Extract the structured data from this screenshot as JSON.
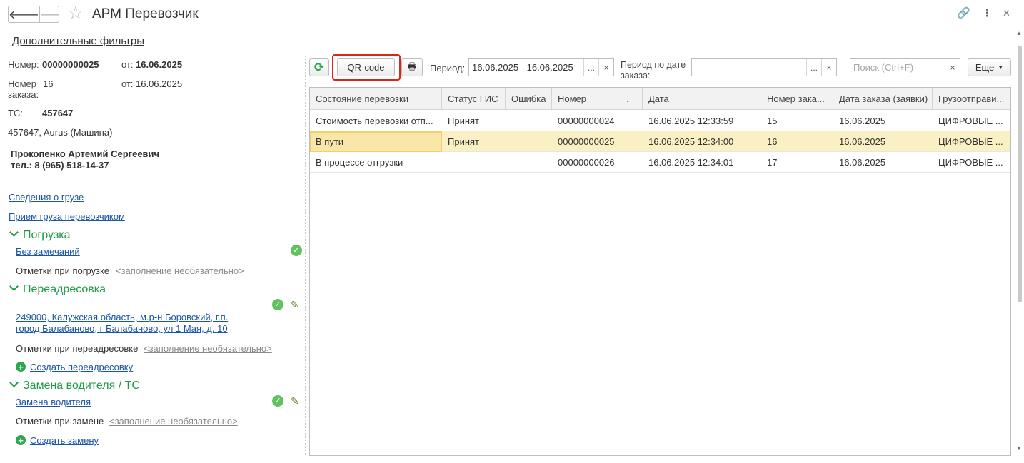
{
  "window": {
    "title": "АРМ Перевозчик",
    "nav_back": "🡐",
    "nav_forward": "🡒",
    "star": "☆",
    "link_icon": "🔗",
    "more_icon": "⋮",
    "close_icon": "✕"
  },
  "filters_link": "Дополнительные фильтры",
  "details": {
    "number_label": "Номер:",
    "number_value": "00000000025",
    "from_label": "от:",
    "number_date": "16.06.2025",
    "order_label_1": "Номер",
    "order_label_2": "заказа:",
    "order_value": "16",
    "order_from_label": "от:",
    "order_date": "16.06.2025",
    "vehicle_label": "ТС:",
    "vehicle_value": "457647",
    "vehicle_desc": "457647, Aurus (Машина)",
    "driver_name": "Прокопенко Артемий Сергеевич",
    "driver_phone": "тел.: 8 (965) 518-14-37"
  },
  "links": {
    "cargo_info": "Сведения о грузе",
    "cargo_accept": "Прием груза перевозчиком"
  },
  "sections": {
    "loading": {
      "title": "Погрузка",
      "link": "Без замечаний",
      "notes_label": "Отметки при погрузке",
      "notes_placeholder": "<заполнение необязательно>"
    },
    "redirect": {
      "title": "Переадресовка",
      "address_line1": "249000, Калужская область, м.р-н Боровский, г.п.",
      "address_line2": "город Балабаново, г Балабаново, ул 1 Мая, д. 10",
      "notes_label": "Отметки при переадресовке",
      "notes_placeholder": "<заполнение необязательно>",
      "create_link": "Создать переадресовку"
    },
    "driver_change": {
      "title": "Замена водителя / ТС",
      "link": "Замена водителя",
      "notes_label": "Отметки при замене",
      "notes_placeholder": "<заполнение необязательно>",
      "create_link": "Создать замену"
    }
  },
  "toolbar": {
    "refresh_icon": "⟳",
    "qr_label": "QR-code",
    "print_icon": "🖶",
    "period_label": "Период:",
    "period_value": "16.06.2025 - 16.06.2025",
    "period_by_order_label_1": "Период по дате",
    "period_by_order_label_2": "заказа:",
    "period_by_order_value": "",
    "search_placeholder": "Поиск (Ctrl+F)",
    "more_label": "Еще",
    "ellipsis": "...",
    "clear": "×"
  },
  "table": {
    "columns": [
      "Состояние перевозки",
      "Статус ГИС",
      "Ошибка",
      "Номер",
      "Дата",
      "Номер заказа",
      "Дата заказа (заявки)",
      "Грузоотправитель"
    ],
    "column_display": [
      "Состояние перевозки",
      "Статус ГИС",
      "Ошибка",
      "Номер",
      "Дата",
      "Номер зака...",
      "Дата заказа (заявки)",
      "Грузоотправи..."
    ],
    "sort_indicator": "↓",
    "rows": [
      [
        "Стоимость перевозки отп...",
        "Принят",
        "",
        "00000000024",
        "16.06.2025 12:33:59",
        "15",
        "16.06.2025",
        "ЦИФРОВЫЕ ..."
      ],
      [
        "В пути",
        "Принят",
        "",
        "00000000025",
        "16.06.2025 12:34:00",
        "16",
        "16.06.2025",
        "ЦИФРОВЫЕ ..."
      ],
      [
        "В процессе отгрузки",
        "",
        "",
        "00000000026",
        "16.06.2025 12:34:01",
        "17",
        "16.06.2025",
        "ЦИФРОВЫЕ ..."
      ]
    ],
    "selected_row": 1
  },
  "colors": {
    "accent_green": "#1f9b48",
    "link_blue": "#1a55a6",
    "highlight_red": "#d9261c",
    "selected_row": "#fbf0c4"
  }
}
